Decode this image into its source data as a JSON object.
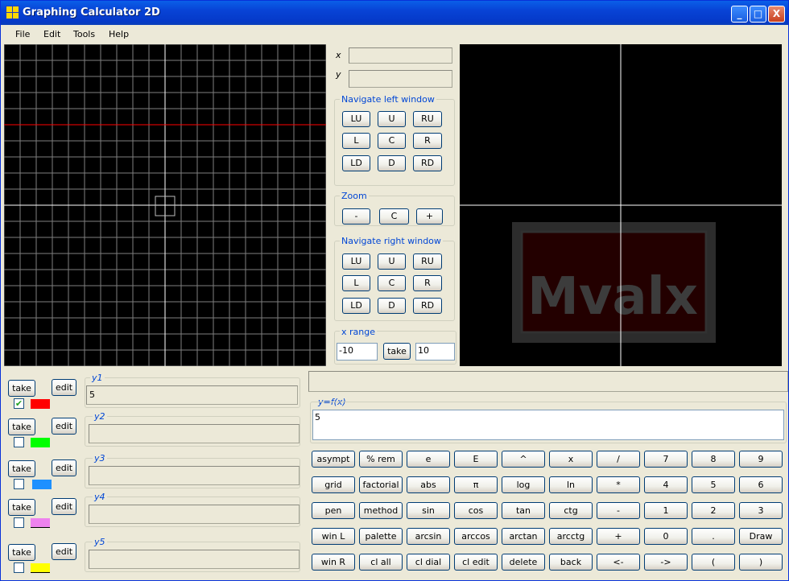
{
  "window": {
    "title": "Graphing Calculator  2D",
    "minimize": "_",
    "maximize": "□",
    "close": "X"
  },
  "menu": {
    "items": [
      "File",
      "Edit",
      "Tools",
      "Help"
    ]
  },
  "coords": {
    "x_label": "x",
    "y_label": "y",
    "x_value": "",
    "y_value": ""
  },
  "nav_left": {
    "title": "Navigate left window",
    "buttons": [
      "LU",
      "U",
      "RU",
      "L",
      "C",
      "R",
      "LD",
      "D",
      "RD"
    ]
  },
  "zoom": {
    "title": "Zoom",
    "buttons": [
      "-",
      "C",
      "+"
    ]
  },
  "nav_right": {
    "title": "Navigate right window",
    "buttons": [
      "LU",
      "U",
      "RU",
      "L",
      "C",
      "R",
      "LD",
      "D",
      "RD"
    ]
  },
  "xrange": {
    "title": "x range",
    "min": "-10",
    "take": "take",
    "max": "10"
  },
  "watermark": {
    "text": "Mvalx"
  },
  "functions": [
    {
      "label": "y1",
      "take": "take",
      "edit": "edit",
      "value": "5",
      "checked": true,
      "color": "#ff0000"
    },
    {
      "label": "y2",
      "take": "take",
      "edit": "edit",
      "value": "",
      "checked": false,
      "color": "#00ff00"
    },
    {
      "label": "y3",
      "take": "take",
      "edit": "edit",
      "value": "",
      "checked": false,
      "color": "#1e90ff"
    },
    {
      "label": "y4",
      "take": "take",
      "edit": "edit",
      "value": "",
      "checked": false,
      "color": "#ee82ee"
    },
    {
      "label": "y5",
      "take": "take",
      "edit": "edit",
      "value": "",
      "checked": false,
      "color": "#ffff00"
    }
  ],
  "colors": {
    "grid": "#7f7f7f",
    "axis": "#ffffff",
    "plot_line": "#ff0000",
    "screen_bg": "#000000",
    "accent_label": "#0046d5"
  },
  "status_line": "",
  "expression": {
    "label": "y=f(x)",
    "value": "5"
  },
  "keypad": [
    [
      "asympt",
      "% rem",
      "e",
      "E",
      "^",
      "x",
      "/",
      "7",
      "8",
      "9"
    ],
    [
      "grid",
      "factorial",
      "abs",
      "π",
      "log",
      "ln",
      "*",
      "4",
      "5",
      "6"
    ],
    [
      "pen",
      "method",
      "sin",
      "cos",
      "tan",
      "ctg",
      "-",
      "1",
      "2",
      "3"
    ],
    [
      "win L",
      "palette",
      "arcsin",
      "arccos",
      "arctan",
      "arcctg",
      "+",
      "0",
      ".",
      "Draw"
    ],
    [
      "win R",
      "cl all",
      "cl dial",
      "cl edit",
      "delete",
      "back",
      "<-",
      "->",
      "(",
      ")"
    ]
  ]
}
